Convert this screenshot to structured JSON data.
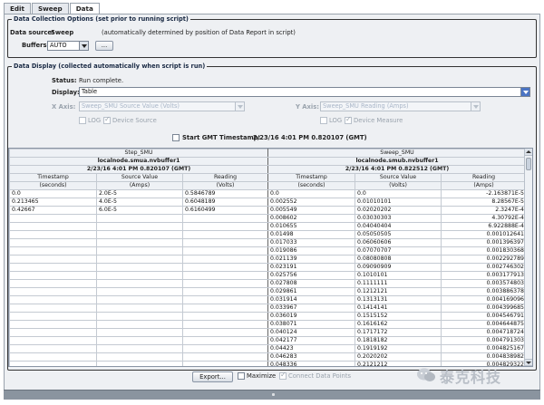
{
  "tabs": [
    {
      "label": "Edit",
      "active": false
    },
    {
      "label": "Sweep",
      "active": false
    },
    {
      "label": "Data",
      "active": true
    }
  ],
  "collection": {
    "title": "Data Collection Options (set prior to running script)",
    "source_label": "Data source:",
    "source_value": "Sweep",
    "source_note": "(automatically determined by position of Data Report in script)",
    "buffers_label": "Buffers:",
    "buffers_value": "AUTO",
    "ellipsis_label": "..."
  },
  "display": {
    "title": "Data Display (collected automatically when script is run)",
    "status_label": "Status:",
    "status_value": "Run complete.",
    "display_label": "Display:",
    "display_value": "Table",
    "xaxis_label": "X Axis:",
    "xaxis_value": "Sweep_SMU Source Value (Volts)",
    "yaxis_label": "Y Axis:",
    "yaxis_value": "Sweep_SMU Reading (Amps)",
    "log_label": "LOG",
    "device_source_label": "Device Source",
    "device_measure_label": "Device Measure",
    "start_gmt_label": "Start GMT Timestamp:",
    "start_gmt_value": "2/23/16 4:01 PM 0.820107 (GMT)"
  },
  "table": {
    "left": {
      "name": "Step_SMU",
      "buffer": "localnode.smua.nvbuffer1",
      "timestamp": "2/23/16 4:01 PM 0.820107 (GMT)",
      "columns": [
        {
          "title": "Timestamp",
          "unit": "(seconds)"
        },
        {
          "title": "Source Value",
          "unit": "(Amps)"
        },
        {
          "title": "Reading",
          "unit": "(Volts)"
        }
      ]
    },
    "right": {
      "name": "Sweep_SMU",
      "buffer": "localnode.smub.nvbuffer1",
      "timestamp": "2/23/16 4:01 PM 0.822512 (GMT)",
      "columns": [
        {
          "title": "Timestamp",
          "unit": "(seconds)"
        },
        {
          "title": "Source Value",
          "unit": "(Volts)"
        },
        {
          "title": "Reading",
          "unit": "(Amps)"
        }
      ]
    },
    "left_rows": [
      [
        "0.0",
        "2.0E-5",
        "0.5846789"
      ],
      [
        "0.213465",
        "4.0E-5",
        "0.6048189"
      ],
      [
        "0.42667",
        "6.0E-5",
        "0.6160499"
      ]
    ],
    "right_rows": [
      [
        "0.0",
        "0.0",
        "-2.163871E-5"
      ],
      [
        "0.002552",
        "0.01010101",
        "8.28567E-5"
      ],
      [
        "0.005549",
        "0.02020202",
        "2.3247E-4"
      ],
      [
        "0.008602",
        "0.03030303",
        "4.30792E-4"
      ],
      [
        "0.010655",
        "0.04040404",
        "6.922888E-4"
      ],
      [
        "0.01498",
        "0.05050505",
        "0.001012641"
      ],
      [
        "0.017033",
        "0.06060606",
        "0.001396397"
      ],
      [
        "0.019086",
        "0.07070707",
        "0.001830368"
      ],
      [
        "0.021139",
        "0.08080808",
        "0.002292789"
      ],
      [
        "0.023191",
        "0.09090909",
        "0.002746302"
      ],
      [
        "0.025756",
        "0.1010101",
        "0.003177913"
      ],
      [
        "0.027808",
        "0.1111111",
        "0.003574803"
      ],
      [
        "0.029861",
        "0.1212121",
        "0.003886378"
      ],
      [
        "0.031914",
        "0.1313131",
        "0.004169096"
      ],
      [
        "0.033967",
        "0.1414141",
        "0.004399685"
      ],
      [
        "0.036019",
        "0.1515152",
        "0.004546791"
      ],
      [
        "0.038071",
        "0.1616162",
        "0.004644875"
      ],
      [
        "0.040124",
        "0.1717172",
        "0.004718724"
      ],
      [
        "0.042177",
        "0.1818182",
        "0.004791303"
      ],
      [
        "0.04423",
        "0.1919192",
        "0.004825167"
      ],
      [
        "0.046283",
        "0.2020202",
        "0.004838982"
      ],
      [
        "0.048336",
        "0.2121212",
        "0.004829322"
      ]
    ]
  },
  "footer": {
    "export_label": "Export...",
    "maximize_label": "Maximize",
    "connect_label": "Connect Data Points"
  },
  "watermark": {
    "text": "泰克科技"
  },
  "colors": {
    "panel_bg": "#eef0f3",
    "accent_blue": "#4a74c4",
    "disabled_text": "#a9b6c8"
  }
}
